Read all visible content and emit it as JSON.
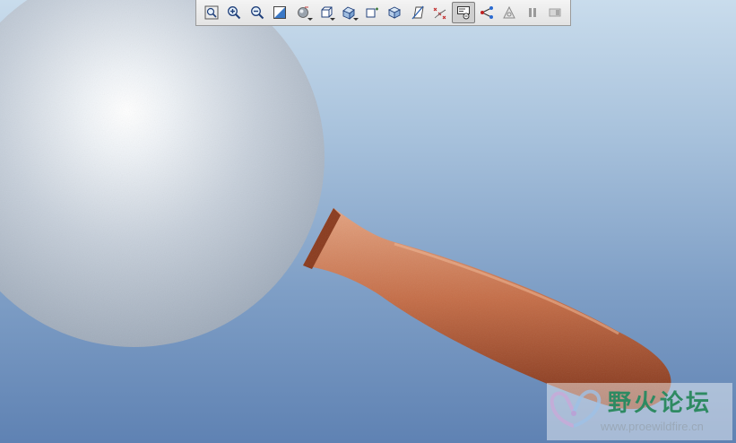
{
  "toolbar": {
    "buttons": [
      {
        "name": "refit-icon"
      },
      {
        "name": "zoom-in-icon"
      },
      {
        "name": "zoom-out-icon"
      },
      {
        "name": "repaint-icon"
      },
      {
        "name": "spin-center-icon"
      },
      {
        "name": "display-style-icon"
      },
      {
        "name": "saved-views-icon"
      },
      {
        "name": "view-manager-icon"
      },
      {
        "name": "datum-planes-icon"
      },
      {
        "name": "datum-axes-icon"
      },
      {
        "name": "datum-points-icon"
      },
      {
        "name": "coordinate-systems-icon",
        "active": true
      },
      {
        "name": "annotations-icon"
      },
      {
        "name": "analysis-icon"
      },
      {
        "name": "pause-icon"
      },
      {
        "name": "regen-icon"
      }
    ]
  },
  "watermark": {
    "title": "野火论坛",
    "url": "www.proewildfire.cn"
  },
  "colors": {
    "background_top": "#c9dcec",
    "background_bottom": "#5f82b3",
    "sphere": "#cbd3de",
    "handle": "#b8603a",
    "watermark_green": "#2e8a62"
  }
}
